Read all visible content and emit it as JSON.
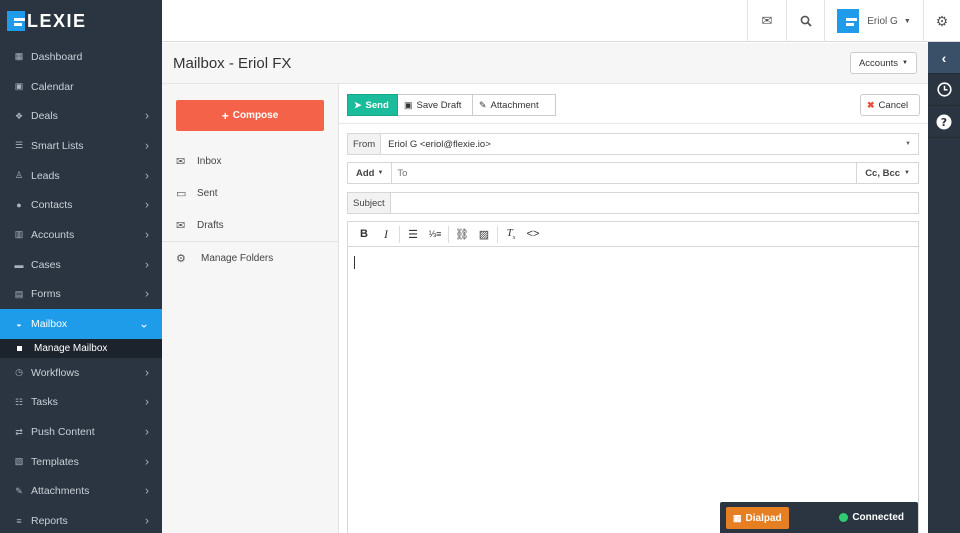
{
  "brand": {
    "logo_text": "LEXIE"
  },
  "sidebar": {
    "items": [
      {
        "label": "Dashboard",
        "icon": "dashboard-icon",
        "glyph": "▦",
        "chevron": false
      },
      {
        "label": "Calendar",
        "icon": "calendar-icon",
        "glyph": "▣",
        "chevron": false
      },
      {
        "label": "Deals",
        "icon": "handshake-icon",
        "glyph": "❖",
        "chevron": true
      },
      {
        "label": "Smart Lists",
        "icon": "list-icon",
        "glyph": "☰",
        "chevron": true
      },
      {
        "label": "Leads",
        "icon": "user-outline-icon",
        "glyph": "♙",
        "chevron": true
      },
      {
        "label": "Contacts",
        "icon": "user-icon",
        "glyph": "●",
        "chevron": true
      },
      {
        "label": "Accounts",
        "icon": "building-icon",
        "glyph": "▥",
        "chevron": true
      },
      {
        "label": "Cases",
        "icon": "briefcase-icon",
        "glyph": "▬",
        "chevron": true
      },
      {
        "label": "Forms",
        "icon": "form-icon",
        "glyph": "▤",
        "chevron": true
      },
      {
        "label": "Mailbox",
        "icon": "inbox-icon",
        "glyph": "◒",
        "chevron": true,
        "active": true
      },
      {
        "label": "Workflows",
        "icon": "clock-icon",
        "glyph": "◷",
        "chevron": true
      },
      {
        "label": "Tasks",
        "icon": "task-list-icon",
        "glyph": "☷",
        "chevron": true
      },
      {
        "label": "Push Content",
        "icon": "retweet-icon",
        "glyph": "⇄",
        "chevron": true
      },
      {
        "label": "Templates",
        "icon": "templates-icon",
        "glyph": "▧",
        "chevron": true
      },
      {
        "label": "Attachments",
        "icon": "paperclip-icon",
        "glyph": "✎",
        "chevron": true
      },
      {
        "label": "Reports",
        "icon": "database-icon",
        "glyph": "≡",
        "chevron": true
      }
    ],
    "sub_item": "Manage Mailbox"
  },
  "topbar": {
    "user_name": "Eriol G"
  },
  "page": {
    "title": "Mailbox - Eriol FX",
    "accounts_label": "Accounts"
  },
  "folders": {
    "compose_label": "Compose",
    "items": [
      {
        "label": "Inbox",
        "icon": "inbox-tray-icon",
        "glyph": "✉"
      },
      {
        "label": "Sent",
        "icon": "folder-icon",
        "glyph": "▭"
      },
      {
        "label": "Drafts",
        "icon": "drafts-icon",
        "glyph": "✉"
      }
    ],
    "manage_label": "Manage Folders"
  },
  "compose": {
    "send_label": "Send",
    "save_draft_label": "Save Draft",
    "attachment_label": "Attachment",
    "cancel_label": "Cancel",
    "from_label": "From",
    "from_value": "Eriol G <eriol@flexie.io>",
    "add_label": "Add",
    "to_placeholder": "To",
    "cc_bcc_label": "Cc, Bcc",
    "subject_label": "Subject",
    "subject_value": ""
  },
  "dialer": {
    "dialpad_label": "Dialpad",
    "status": "Connected"
  },
  "colors": {
    "sidebar_bg": "#2b3541",
    "accent": "#1e9cea",
    "compose": "#f4624a",
    "send": "#1bbc9b",
    "dialpad": "#e67e22",
    "connected": "#2ecc71"
  }
}
